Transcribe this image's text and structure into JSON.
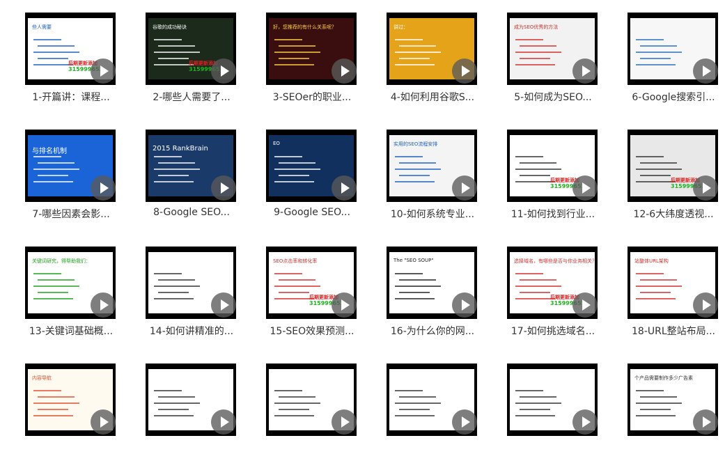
{
  "colors": {
    "watermark_red": "#e02020",
    "watermark_green": "#20b020",
    "play_overlay": "#5a5a5a",
    "caption_text": "#333333"
  },
  "videos": [
    {
      "title": "1-开篇讲：课程...",
      "bg": "#ffffff",
      "slide_text": "些人需要",
      "slide_color": "#2060c0",
      "watermark": true,
      "icon": "play-icon"
    },
    {
      "title": "2-哪些人需要了...",
      "bg": "#1b2a1b",
      "slide_text": "谷歌的成功秘诀",
      "slide_color": "#ffffff",
      "watermark": true,
      "icon": "play-icon"
    },
    {
      "title": "3-SEOer的职业...",
      "bg": "#3a0e0e",
      "slide_text": "好，您推荐的有什么关系呢？",
      "slide_color": "#ffd040",
      "watermark": false,
      "icon": "play-icon"
    },
    {
      "title": "4-如何利用谷歌S...",
      "bg": "#e4a318",
      "slide_text": "讲过：",
      "slide_color": "#ffffff",
      "watermark": false,
      "icon": "play-icon"
    },
    {
      "title": "5-如何成为SEO...",
      "bg": "#f2f2f2",
      "slide_text": "成为SEO优秀的方法",
      "slide_color": "#d03030",
      "watermark": false,
      "icon": "play-icon"
    },
    {
      "title": "6-Google搜索引...",
      "bg": "#f7f7f7",
      "slide_text": "",
      "slide_color": "#2a6fc0",
      "watermark": false,
      "icon": "play-icon"
    },
    {
      "title": "7-哪些因素会影...",
      "bg": "#1a64d8",
      "slide_text": "与排名机制",
      "slide_color": "#ffffff",
      "watermark": false,
      "icon": "play-icon"
    },
    {
      "title": "8-Google SEO...",
      "bg": "#1a3a6a",
      "slide_text": "2015 RankBrain",
      "slide_color": "#ffffff",
      "watermark": false,
      "icon": "play-icon"
    },
    {
      "title": "9-Google SEO...",
      "bg": "#12305e",
      "slide_text": "EO",
      "slide_color": "#ffffff",
      "watermark": false,
      "icon": "play-icon"
    },
    {
      "title": "10-如何系统专业...",
      "bg": "#f4f4f4",
      "slide_text": "实用的SEO流程安排",
      "slide_color": "#2060c0",
      "watermark": false,
      "icon": "play-icon"
    },
    {
      "title": "11-如何找到行业...",
      "bg": "#ffffff",
      "slide_text": "",
      "slide_color": "#333333",
      "watermark": true,
      "icon": "play-icon"
    },
    {
      "title": "12-6大纬度透视...",
      "bg": "#e8e8e8",
      "slide_text": "",
      "slide_color": "#333333",
      "watermark": true,
      "icon": "play-icon"
    },
    {
      "title": "13-关键词基础概...",
      "bg": "#ffffff",
      "slide_text": "关键词研究，得帮助我们：",
      "slide_color": "#20a020",
      "watermark": false,
      "icon": "play-icon"
    },
    {
      "title": "14-如何讲精准的...",
      "bg": "#ffffff",
      "slide_text": "",
      "slide_color": "#333333",
      "watermark": false,
      "icon": "play-icon"
    },
    {
      "title": "15-SEO效果预测...",
      "bg": "#ffffff",
      "slide_text": "SEO点击率和转化率",
      "slide_color": "#d03030",
      "watermark": true,
      "icon": "play-icon"
    },
    {
      "title": "16-为什么你的网...",
      "bg": "#ffffff",
      "slide_text": "The \"SEO SOUP\"",
      "slide_color": "#222222",
      "watermark": false,
      "icon": "play-icon"
    },
    {
      "title": "17-如何挑选域名...",
      "bg": "#ffffff",
      "slide_text": "选择域名，有哪些是否与你业务相关？",
      "slide_color": "#d03030",
      "watermark": true,
      "icon": "play-icon"
    },
    {
      "title": "18-URL整站布局...",
      "bg": "#ffffff",
      "slide_text": "站整体URL架构",
      "slide_color": "#d03030",
      "watermark": false,
      "icon": "play-icon"
    },
    {
      "title": "",
      "bg": "#fffaf0",
      "slide_text": "内容导航",
      "slide_color": "#e05030",
      "watermark": false,
      "icon": "play-icon"
    },
    {
      "title": "",
      "bg": "#ffffff",
      "slide_text": "",
      "slide_color": "#333333",
      "watermark": false,
      "icon": "play-icon"
    },
    {
      "title": "",
      "bg": "#ffffff",
      "slide_text": "",
      "slide_color": "#333333",
      "watermark": false,
      "icon": "play-icon"
    },
    {
      "title": "",
      "bg": "#ffffff",
      "slide_text": "",
      "slide_color": "#333333",
      "watermark": false,
      "icon": "play-icon"
    },
    {
      "title": "",
      "bg": "#ffffff",
      "slide_text": "",
      "slide_color": "#333333",
      "watermark": false,
      "icon": "play-icon"
    },
    {
      "title": "",
      "bg": "#ffffff",
      "slide_text": "个产品需要制作多少广告素",
      "slide_color": "#333333",
      "watermark": false,
      "icon": "play-icon"
    }
  ],
  "watermark": {
    "line1": "后期更新添加",
    "line2": "315999653"
  }
}
